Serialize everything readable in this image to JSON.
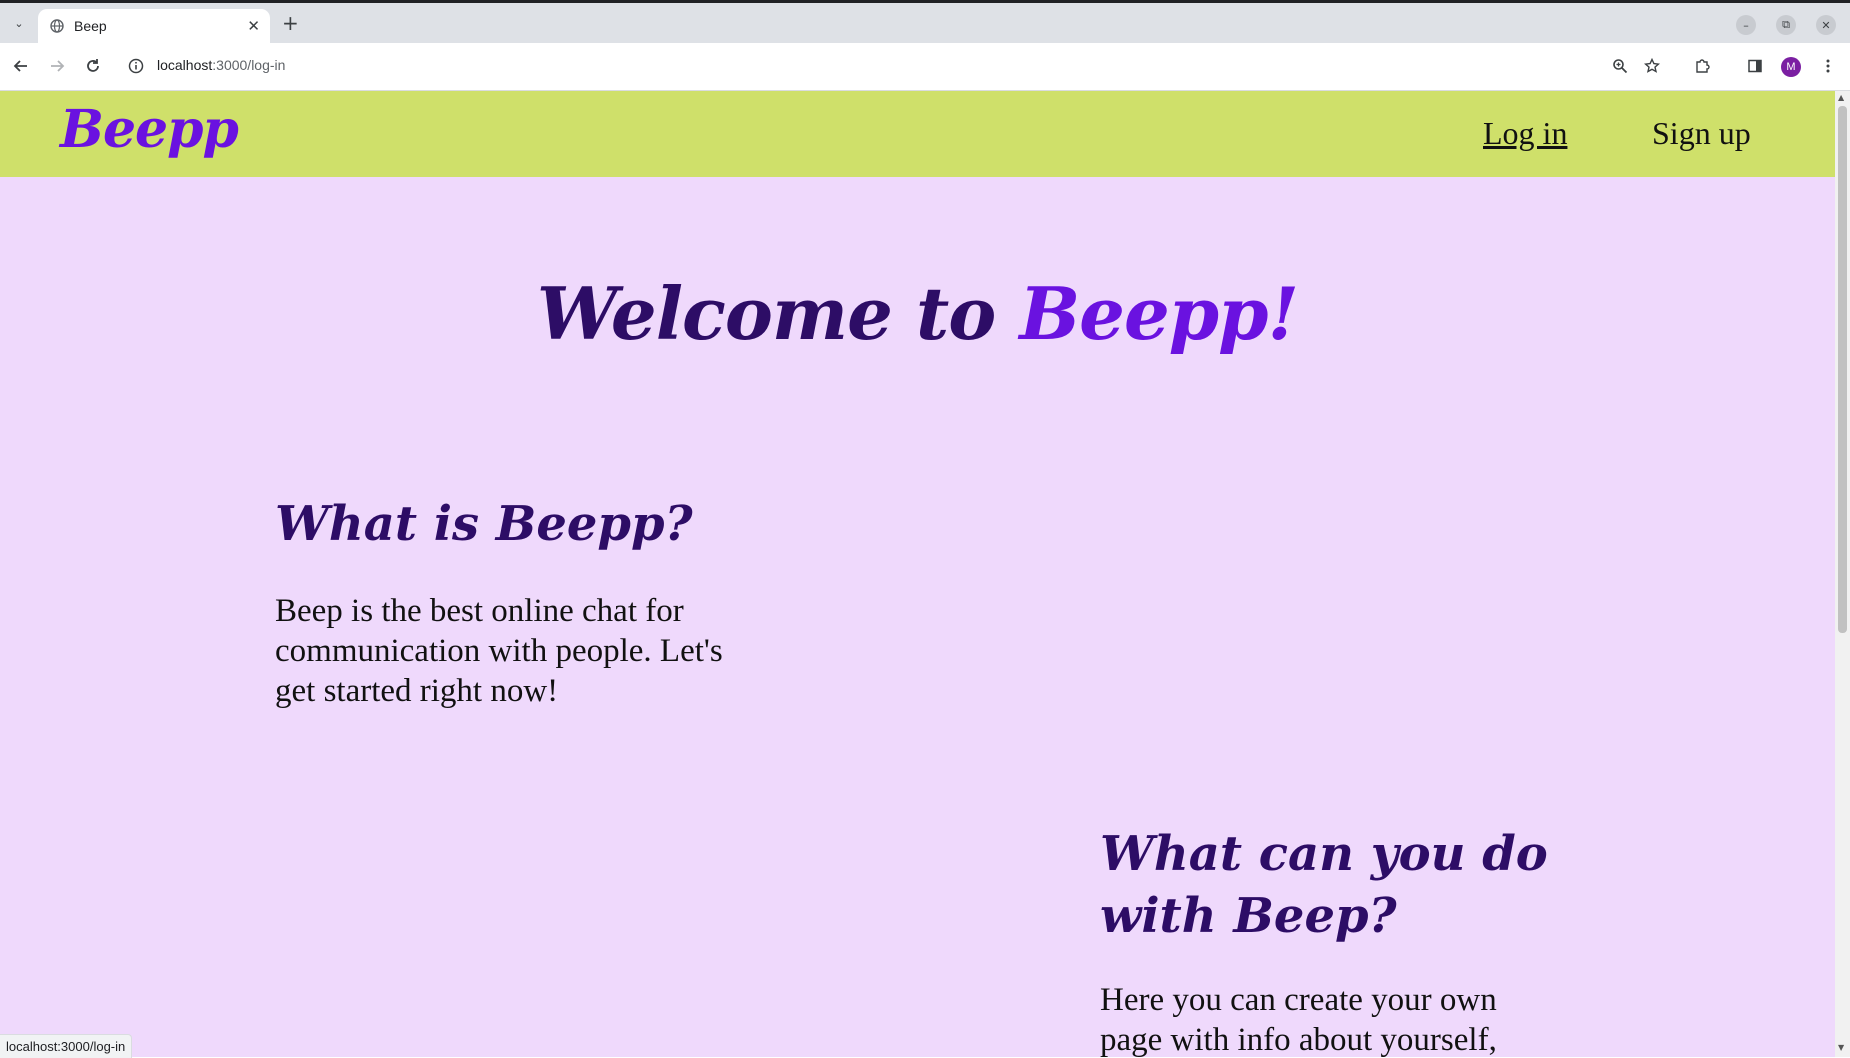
{
  "browser": {
    "tab_title": "Beep",
    "url_host": "localhost",
    "url_path": ":3000/log-in",
    "profile_initial": "M",
    "status_url": "localhost:3000/log-in"
  },
  "header": {
    "logo": "Beepp",
    "login_label": "Log in",
    "signup_label": "Sign up"
  },
  "hero": {
    "prefix": "Welcome to ",
    "brand": "Beepp",
    "suffix": "!"
  },
  "section1": {
    "title": "What is Beepp?",
    "text": "Beep is the best online chat for communication with people. Let's get started right now!"
  },
  "section2": {
    "title": "What can you do with Beep?",
    "text": "Here you can create your own page with info about yourself,"
  },
  "colors": {
    "header_bg": "#cfe06a",
    "page_bg": "#efd9fc",
    "brand": "#6a12e0",
    "heading": "#2d0d66"
  }
}
